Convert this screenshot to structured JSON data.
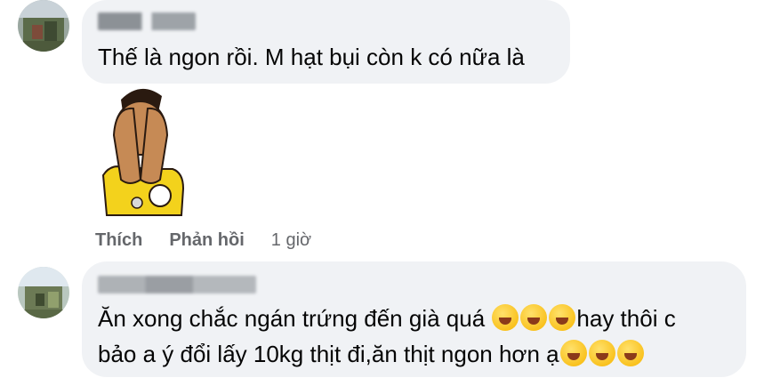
{
  "comments": [
    {
      "text": "Thế là ngon rồi. M hạt bụi còn k có nữa là",
      "sticker": "referee-covering-eyes-sticker",
      "actions": {
        "like": "Thích",
        "reply": "Phản hồi",
        "time": "1 giờ"
      }
    },
    {
      "line1": "Ăn xong chắc ngán trứng đến già quá ",
      "line1_end": "hay thôi c",
      "line2": "bảo a ý đổi lấy 10kg thịt đi,ăn thịt ngon hơn ạ",
      "emojis_line1": "rolling-on-floor-laughing-emoji",
      "emojis_line2": "grinning-sweat-emoji"
    }
  ],
  "colors": {
    "bubble": "#f0f2f5",
    "muted": "#65676b",
    "text": "#050505"
  }
}
